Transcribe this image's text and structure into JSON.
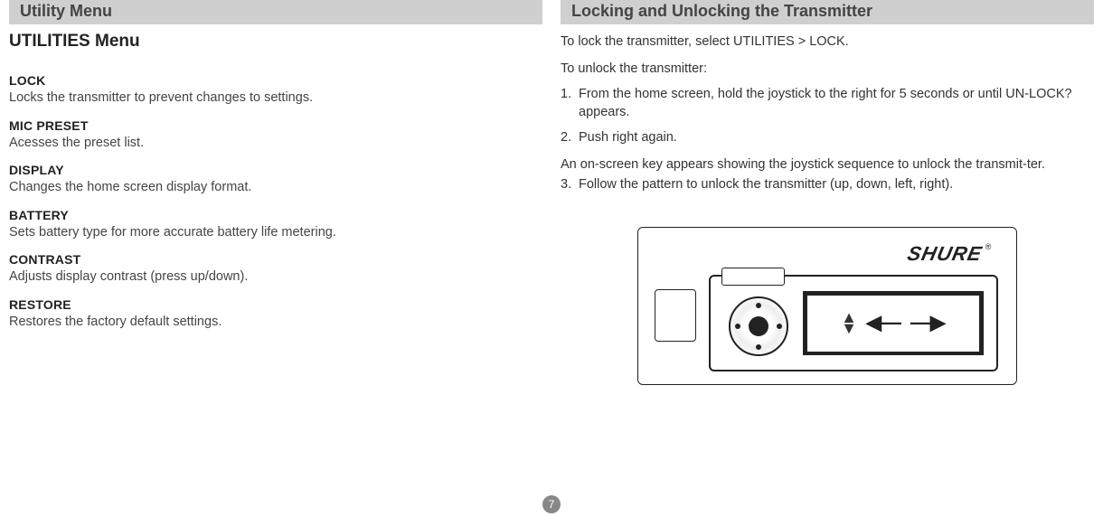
{
  "left": {
    "section_title": "Utility Menu",
    "heading": "UTILITIES Menu",
    "items": [
      {
        "term": "LOCK",
        "desc": "Locks the transmitter to prevent changes to settings."
      },
      {
        "term": "MIC PRESET",
        "desc": "Acesses the preset list."
      },
      {
        "term": "DISPLAY",
        "desc": "Changes the home screen display format."
      },
      {
        "term": "BATTERY",
        "desc": "Sets battery type for more accurate battery life metering."
      },
      {
        "term": "CONTRAST",
        "desc": "Adjusts display contrast (press up/down)."
      },
      {
        "term": "RESTORE",
        "desc": "Restores the factory default settings."
      }
    ]
  },
  "right": {
    "section_title": "Locking and Unlocking the Transmitter",
    "p1": "To lock the transmitter, select UTILITIES > LOCK.",
    "p2": "To unlock the transmitter:",
    "steps": [
      {
        "n": "1.",
        "t": "From the home screen, hold the joystick to the right for 5 seconds or until UN-LOCK? appears."
      },
      {
        "n": "2.",
        "t": "Push right again."
      }
    ],
    "p3": "An on-screen key appears showing the joystick sequence to unlock the transmit-ter.",
    "step3": {
      "n": "3.",
      "t": "Follow the pattern to unlock the transmitter (up, down, left, right)."
    },
    "brand": "SHURE",
    "reg": "®"
  },
  "page": "7"
}
